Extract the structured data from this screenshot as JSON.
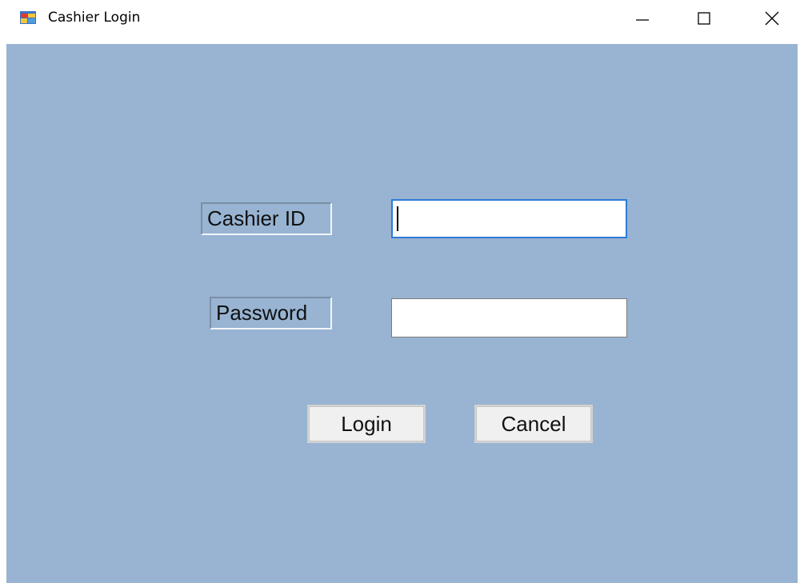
{
  "window": {
    "title": "Cashier Login",
    "icon": "app-form-icon",
    "controls": {
      "minimize": "minimize-icon",
      "maximize": "maximize-icon",
      "close": "close-icon"
    }
  },
  "form": {
    "cashier_id_label": "Cashier ID",
    "cashier_id_value": "",
    "password_label": "Password",
    "password_value": "",
    "login_label": "Login",
    "cancel_label": "Cancel"
  },
  "colors": {
    "client_background": "#98b4d2",
    "focus_border": "#2d7bd4",
    "button_face": "#f0f0f0"
  }
}
